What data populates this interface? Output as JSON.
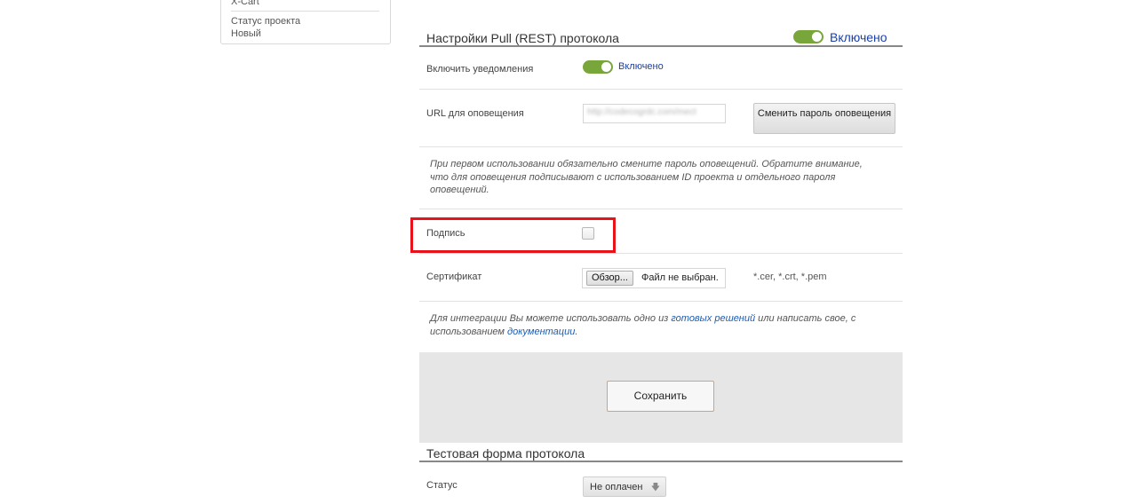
{
  "sidebar": {
    "cms_name": "X-Cart",
    "status_label": "Статус проекта",
    "status_value": "Новый"
  },
  "pull_settings": {
    "title": "Настройки Pull (REST) протокола",
    "enabled_label": "Включено",
    "notifications": {
      "label": "Включить уведомления",
      "state": "Включено"
    },
    "url": {
      "label": "URL для оповещения",
      "value": "http://codecogrdc.com/mect"
    },
    "change_password_button": "Сменить пароль оповещения",
    "note": "При первом использовании обязательно смените пароль оповещений. Обратите внимание, что для оповещения подписывают с использованием ID проекта и отдельного пароля оповещений.",
    "signature": {
      "label": "Подпись",
      "checked": false
    },
    "certificate": {
      "label": "Сертификат",
      "browse_button": "Обзор...",
      "file_name": "Файл не выбран.",
      "extensions": "*.cer, *.crt, *.pem"
    },
    "integration": {
      "text_before": "Для интеграции Вы можете использовать одно из ",
      "link_solutions": "готовых решений",
      "text_middle": " или написать свое, с использованием ",
      "link_docs": "документации",
      "text_after": "."
    },
    "save_button": "Сохранить"
  },
  "test_form": {
    "title": "Тестовая форма протокола",
    "status": {
      "label": "Статус",
      "value": "Не оплачен"
    }
  },
  "colors": {
    "toggle_on": "#78a63a",
    "link": "#1a3fa8",
    "highlight": "#e8121b",
    "save_border": "#f0a51c"
  },
  "icons": {
    "select_arrow": "arrow-down-icon"
  }
}
